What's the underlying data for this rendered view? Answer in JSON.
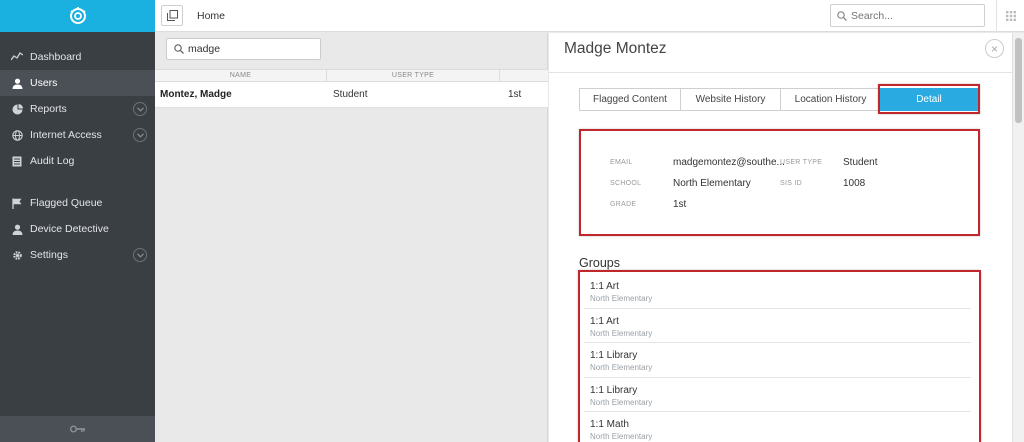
{
  "colors": {
    "brand": "#1ab0e0",
    "sidebar": "#3a3f44",
    "accent": "#29abe2",
    "highlight": "#c0262c"
  },
  "sidebar": {
    "items": [
      {
        "label": "Dashboard",
        "icon": "dashboard-icon"
      },
      {
        "label": "Users",
        "icon": "user-icon",
        "active": true
      },
      {
        "label": "Reports",
        "icon": "pie-chart-icon",
        "expandable": true
      },
      {
        "label": "Internet Access",
        "icon": "globe-icon",
        "expandable": true
      },
      {
        "label": "Audit Log",
        "icon": "list-icon"
      },
      {
        "label": "Flagged Queue",
        "icon": "flag-icon"
      },
      {
        "label": "Device Detective",
        "icon": "user-icon"
      },
      {
        "label": "Settings",
        "icon": "gear-icon",
        "expandable": true
      }
    ]
  },
  "topbar": {
    "breadcrumb": "Home",
    "search_placeholder": "Search..."
  },
  "list": {
    "search_value": "madge",
    "columns": [
      "NAME",
      "USER TYPE",
      ""
    ],
    "rows": [
      {
        "name": "Montez, Madge",
        "user_type": "Student",
        "grade": "1st"
      }
    ]
  },
  "detail": {
    "title": "Madge Montez",
    "tabs": [
      "Flagged Content",
      "Website History",
      "Location History",
      "Detail"
    ],
    "active_tab": "Detail",
    "fields": {
      "email_label": "EMAIL",
      "email": "madgemontez@southe...",
      "user_type_label": "USER TYPE",
      "user_type": "Student",
      "school_label": "SCHOOL",
      "school": "North Elementary",
      "sis_label": "SIS ID",
      "sis_id": "1008",
      "grade_label": "GRADE",
      "grade": "1st"
    },
    "groups_title": "Groups",
    "groups": [
      {
        "name": "1:1 Art",
        "school": "North Elementary"
      },
      {
        "name": "1:1 Art",
        "school": "North Elementary"
      },
      {
        "name": "1:1 Library",
        "school": "North Elementary"
      },
      {
        "name": "1:1 Library",
        "school": "North Elementary"
      },
      {
        "name": "1:1 Math",
        "school": "North Elementary"
      }
    ]
  }
}
